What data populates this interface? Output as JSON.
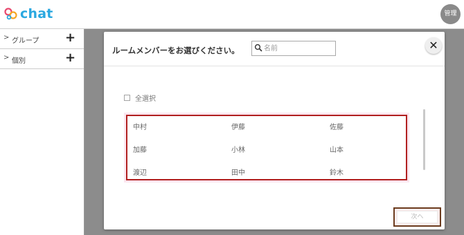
{
  "app": {
    "logo_text": "chat",
    "admin_label": "管理"
  },
  "sidebar": {
    "items": [
      {
        "label": "グループ"
      },
      {
        "label": "個別"
      }
    ]
  },
  "modal": {
    "title": "ルームメンバーをお選びください。",
    "search_placeholder": "名前",
    "select_all_label": "全選択",
    "members": [
      "中村",
      "伊藤",
      "佐藤",
      "加藤",
      "小林",
      "山本",
      "渡辺",
      "田中",
      "鈴木"
    ],
    "next_label": "次へ"
  },
  "colors": {
    "accent": "#2aa8e0",
    "logo_pink": "#e8486e",
    "logo_orange": "#f5a623",
    "highlight_border": "#b11f1f",
    "backdrop": "#8c8c8c"
  },
  "icons": [
    "chat-logo-icon",
    "chevron-right-icon",
    "plus-icon",
    "search-icon",
    "close-icon"
  ]
}
